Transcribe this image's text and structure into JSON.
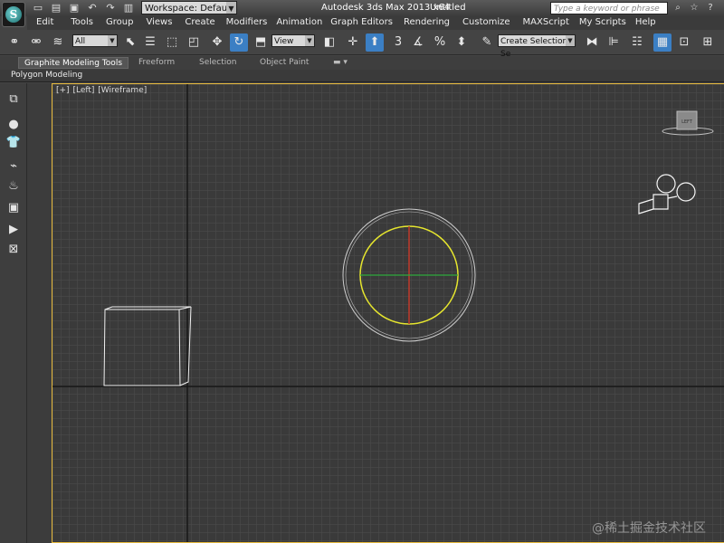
{
  "titlebar": {
    "app_title": "Autodesk 3ds Max  2013 x64",
    "doc_title": "Untitled",
    "workspace_label": "Workspace: Default",
    "search_placeholder": "Type a keyword or phrase"
  },
  "menu": {
    "items": [
      "Edit",
      "Tools",
      "Group",
      "Views",
      "Create",
      "Modifiers",
      "Animation",
      "Graph Editors",
      "Rendering",
      "Customize",
      "MAXScript",
      "My Scripts",
      "Help"
    ]
  },
  "toolbar": {
    "selection_filter": "All",
    "reference_coord": "View",
    "create_selection_set": "Create Selection Se"
  },
  "ribbon": {
    "tabs": [
      "Graphite Modeling Tools",
      "Freeform",
      "Selection",
      "Object Paint"
    ],
    "panel": "Polygon Modeling"
  },
  "viewport": {
    "label_plus": "[+]",
    "label_view": "[Left]",
    "label_shading": "[Wireframe]",
    "viewcube_label": "LEFT",
    "watermark": "@稀土掘金技术社区",
    "active_border_color": "#e6b93c",
    "selected_object_color": "#e6e62e"
  },
  "colors": {
    "background": "#3a3a3a",
    "grid_minor": "#4a4a4a",
    "grid_major": "#1e1e1e"
  }
}
